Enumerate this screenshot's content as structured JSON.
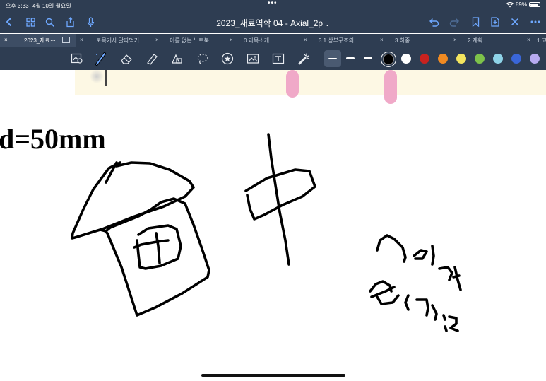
{
  "status_bar": {
    "time": "오후 3:33",
    "date": "4월 10일 월요일",
    "dots": "•••",
    "battery": "89%",
    "battery_level": 0.89
  },
  "title_bar": {
    "title": "2023_재료역학 04 - Axial_2p",
    "title_chevron": "⌄"
  },
  "tabs": [
    {
      "label": "2023_재료···",
      "active": true
    },
    {
      "label": "토목기사 말따먹기",
      "active": false
    },
    {
      "label": "이름 없는 노트북",
      "active": false
    },
    {
      "label": "0.과목소개",
      "active": false
    },
    {
      "label": "3.1.상부구조의...",
      "active": false
    },
    {
      "label": "3.하중",
      "active": false
    },
    {
      "label": "2.계획",
      "active": false
    },
    {
      "label": "1.고",
      "active": false
    }
  ],
  "tab_close_glyph": "×",
  "toolbar": {
    "tools": [
      "lasso-select-icon",
      "pen-icon",
      "eraser-icon",
      "highlighter-icon",
      "shapes-icon",
      "lasso-icon",
      "sticker-icon",
      "image-icon",
      "textbox-icon",
      "laser-pointer-icon"
    ],
    "selected_tool": "pen-icon",
    "selected_color": "#000000",
    "colors": [
      "#000000",
      "#ffffff",
      "#c8221f",
      "#f08a22",
      "#f3e55f",
      "#7dc24a",
      "#8ed3e8",
      "#3a66d8",
      "#b7aaf0"
    ]
  },
  "canvas": {
    "heading": "d=50mm",
    "ink_color": "#000000",
    "highlight_color": "#f0a9c8"
  }
}
